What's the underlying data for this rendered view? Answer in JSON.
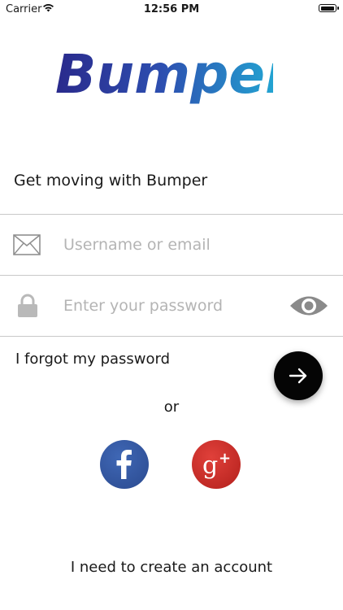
{
  "status_bar": {
    "carrier": "Carrier",
    "time": "12:56 PM"
  },
  "brand": {
    "logo_text": "Bumper",
    "gradient_start": "#2a2a8c",
    "gradient_end": "#21b3d8"
  },
  "tagline": "Get moving with Bumper",
  "username": {
    "placeholder": "Username or email",
    "value": "",
    "icon": "envelope-icon"
  },
  "password": {
    "placeholder": "Enter your password",
    "value": "",
    "icon": "lock-icon",
    "toggle_icon": "eye-icon"
  },
  "forgot_password": "I forgot my password",
  "submit": {
    "icon": "arrow-right-icon",
    "color": "#050505"
  },
  "or_label": "or",
  "social": [
    {
      "name": "facebook",
      "icon": "facebook-icon",
      "color": "#3b5998"
    },
    {
      "name": "google-plus",
      "icon": "google-plus-icon",
      "color": "#d23a32"
    }
  ],
  "create_account": "I need to create an account"
}
